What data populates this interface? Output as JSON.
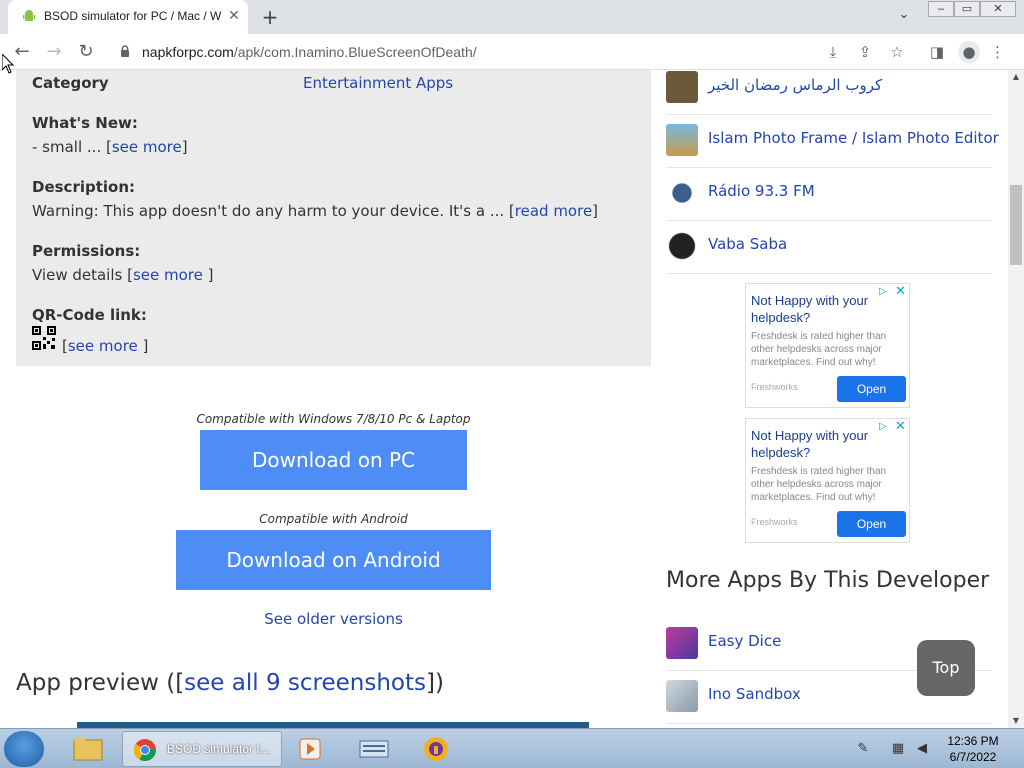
{
  "browser": {
    "tab_title": "BSOD simulator for PC / Mac / W",
    "tab_close": "✕",
    "new_tab": "+",
    "url_host": "napkforpc.com",
    "url_path": "/apk/com.Inamino.BlueScreenOfDeath/"
  },
  "info": {
    "category_label": "Category",
    "category_value": "Entertainment Apps",
    "whatsnew_label": "What's New:",
    "whatsnew_text": "- small ... [",
    "whatsnew_link": "see more",
    "whatsnew_end": "]",
    "description_label": "Description:",
    "description_text": "Warning: This app doesn't do any harm to your device. It's a ... [",
    "description_link": "read more",
    "description_end": "]",
    "permissions_label": "Permissions:",
    "permissions_text": "View details [",
    "permissions_link": "see more ",
    "permissions_end": "]",
    "qr_label": "QR-Code link:",
    "qr_text": "[",
    "qr_link": "see more ",
    "qr_end": "]"
  },
  "downloads": {
    "pc_compat": "Compatible with Windows 7/8/10 Pc & Laptop",
    "pc_button": "Download on PC",
    "android_compat": "Compatible with Android",
    "android_button": "Download on Android",
    "older_versions": "See older versions"
  },
  "preview": {
    "prefix": "App preview ([",
    "link": "see all 9 screenshots",
    "suffix": "])"
  },
  "related_apps": [
    {
      "name": "كروب الرماس رمضان الخير",
      "icon": "ramadan-icon",
      "color": "#6b5a3a"
    },
    {
      "name": "Islam Photo Frame / Islam Photo Editor",
      "icon": "mosque-icon",
      "color": "#c49a4a"
    },
    {
      "name": "Rádio 93.3 FM",
      "icon": "radio-icon",
      "color": "#3a5f8a"
    },
    {
      "name": "Vaba Saba",
      "icon": "vaba-saba-icon",
      "color": "#222222"
    }
  ],
  "ads": [
    {
      "headline": "Not Happy with your helpdesk?",
      "body": "Freshdesk is rated higher than other helpdesks across major marketplaces. Find out why!",
      "brand": "Freshworks",
      "cta": "Open"
    },
    {
      "headline": "Not Happy with your helpdesk?",
      "body": "Freshdesk is rated higher than other helpdesks across major marketplaces. Find out why!",
      "brand": "Freshworks",
      "cta": "Open"
    }
  ],
  "more_apps": {
    "title": "More Apps By This Developer",
    "items": [
      {
        "name": "Easy Dice",
        "icon": "dice-icon",
        "color": "#c03aa0"
      },
      {
        "name": "Ino Sandbox",
        "icon": "sandbox-icon",
        "color": "#8a9aa8"
      }
    ]
  },
  "top_button": "Top",
  "taskbar": {
    "active_label": "BSOD simulator f...",
    "time": "12:36 PM",
    "date": "6/7/2022"
  }
}
